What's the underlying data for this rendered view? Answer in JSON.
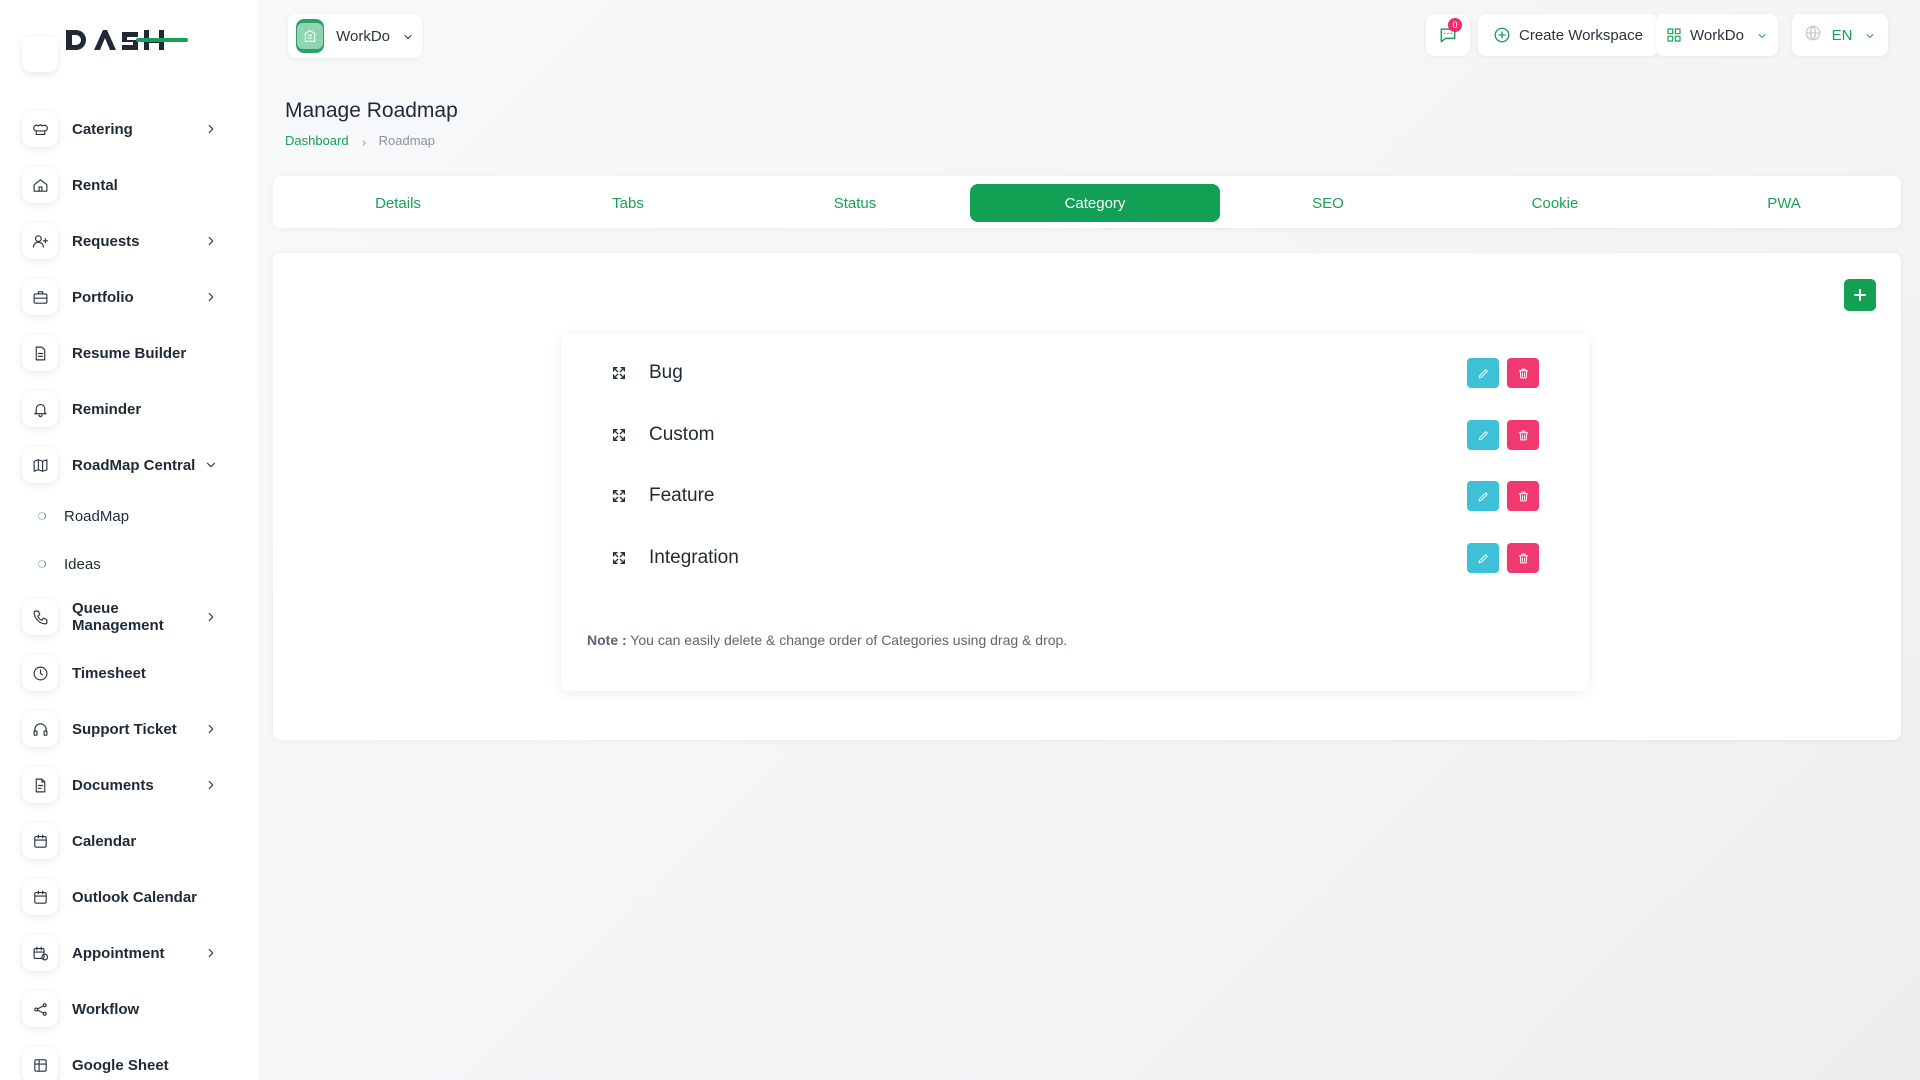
{
  "sidebar": {
    "logo_text": "DASH",
    "items": [
      {
        "label": "Catering",
        "icon": "chef-hat-icon",
        "has_children": true
      },
      {
        "label": "Rental",
        "icon": "home-icon",
        "has_children": false
      },
      {
        "label": "Requests",
        "icon": "user-plus-icon",
        "has_children": true
      },
      {
        "label": "Portfolio",
        "icon": "briefcase-icon",
        "has_children": true
      },
      {
        "label": "Resume Builder",
        "icon": "file-text-icon",
        "has_children": false
      },
      {
        "label": "Reminder",
        "icon": "bell-icon",
        "has_children": false
      },
      {
        "label": "RoadMap Central",
        "icon": "map-icon",
        "has_children": true,
        "expanded": true
      },
      {
        "label": "Queue Management",
        "icon": "phone-icon",
        "has_children": true
      },
      {
        "label": "Timesheet",
        "icon": "clock-icon",
        "has_children": false
      },
      {
        "label": "Support Ticket",
        "icon": "headphones-icon",
        "has_children": true
      },
      {
        "label": "Documents",
        "icon": "file-icon",
        "has_children": true
      },
      {
        "label": "Calendar",
        "icon": "calendar-icon",
        "has_children": false
      },
      {
        "label": "Outlook Calendar",
        "icon": "calendar-icon",
        "has_children": false
      },
      {
        "label": "Appointment",
        "icon": "calendar-clock-icon",
        "has_children": true
      },
      {
        "label": "Workflow",
        "icon": "share-icon",
        "has_children": false
      },
      {
        "label": "Google Sheet",
        "icon": "table-icon",
        "has_children": false
      }
    ],
    "sub_items": [
      {
        "label": "RoadMap"
      },
      {
        "label": "Ideas"
      }
    ]
  },
  "header": {
    "workspace_name": "WorkDo",
    "message_count": "0",
    "create_workspace_label": "Create Workspace",
    "user_label": "WorkDo",
    "language": "EN"
  },
  "page": {
    "title": "Manage Roadmap",
    "breadcrumb": {
      "home": "Dashboard",
      "current": "Roadmap"
    }
  },
  "tabs": [
    {
      "label": "Details",
      "active": false
    },
    {
      "label": "Tabs",
      "active": false
    },
    {
      "label": "Status",
      "active": false
    },
    {
      "label": "Category",
      "active": true
    },
    {
      "label": "SEO",
      "active": false
    },
    {
      "label": "Cookie",
      "active": false
    },
    {
      "label": "PWA",
      "active": false
    }
  ],
  "categories": [
    {
      "name": "Bug"
    },
    {
      "name": "Custom"
    },
    {
      "name": "Feature"
    },
    {
      "name": "Integration"
    }
  ],
  "note": {
    "label": "Note :",
    "text": " You can easily delete & change order of Categories using drag & drop."
  },
  "colors": {
    "primary": "#12a154",
    "edit": "#3ec0d6",
    "delete": "#f1386f",
    "badge": "#ef2d6a"
  }
}
